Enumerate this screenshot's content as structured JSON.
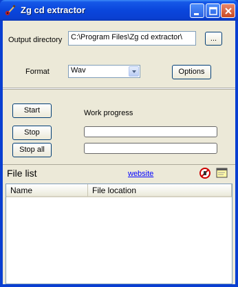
{
  "window": {
    "title": "Zg cd extractor",
    "icon": "guitar-icon",
    "controls": [
      "minimize-icon",
      "maximize-icon",
      "close-icon"
    ]
  },
  "settings": {
    "output_directory_label": "Output directory",
    "output_directory_value": "C:\\Program Files\\Zg cd extractor\\",
    "browse_label": "...",
    "format_label": "Format",
    "format_value": "Wav",
    "options_label": "Options"
  },
  "actions": {
    "start_label": "Start",
    "stop_label": "Stop",
    "stop_all_label": "Stop all",
    "work_progress_label": "Work progress",
    "progress_track_1": 0,
    "progress_track_2": 0
  },
  "file_list": {
    "title": "File list",
    "website_link": "website",
    "toolbar_icons": [
      "remove-icon",
      "note-icon"
    ],
    "columns": [
      "Name",
      "File location"
    ],
    "rows": []
  },
  "colors": {
    "titlebar": "#0a3fd1",
    "client": "#ece9d8",
    "link": "#0000ff"
  }
}
